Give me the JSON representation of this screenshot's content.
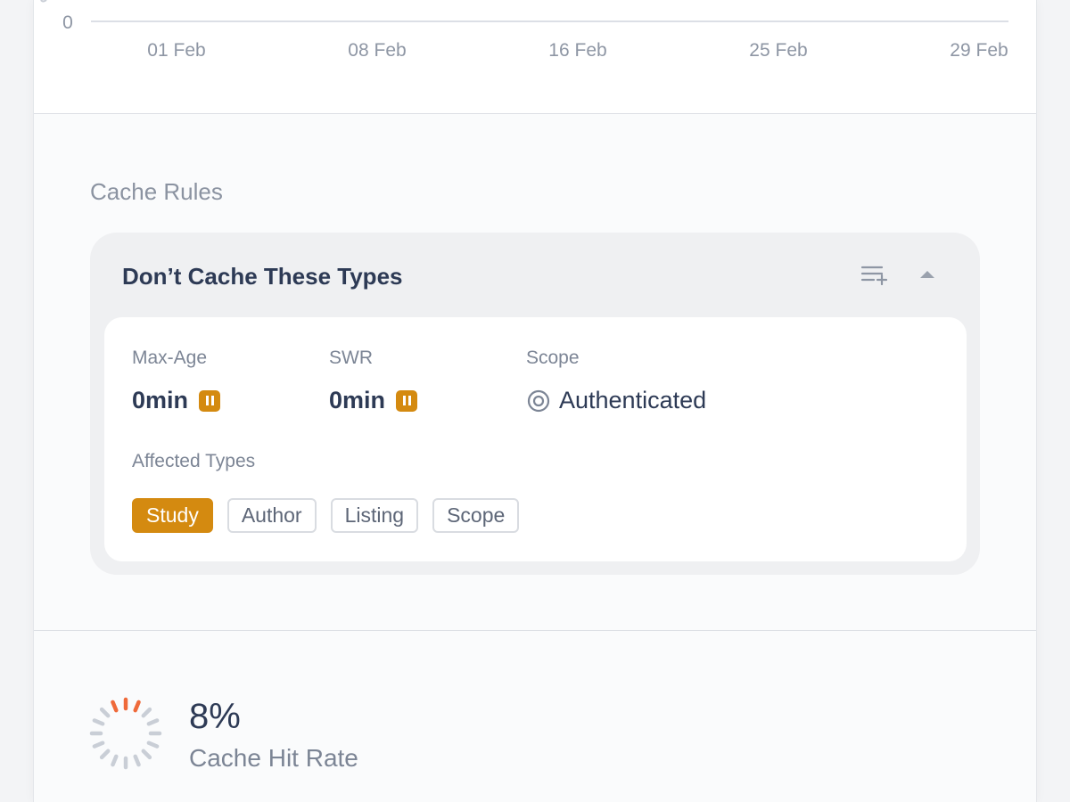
{
  "chart_data": {
    "type": "line",
    "x_ticks": [
      "01 Feb",
      "08 Feb",
      "16 Feb",
      "25 Feb",
      "29 Feb"
    ],
    "y_ticks": [
      "0"
    ],
    "grid": true
  },
  "cache_rules": {
    "section_title": "Cache Rules",
    "rule": {
      "title": "Don’t Cache These Types",
      "add_icon": "list-add-icon",
      "collapse_icon": "caret-up-icon",
      "max_age": {
        "label": "Max-Age",
        "value": "0min",
        "badge_icon": "pause-icon"
      },
      "swr": {
        "label": "SWR",
        "value": "0min",
        "badge_icon": "pause-icon"
      },
      "scope": {
        "label": "Scope",
        "value": "Authenticated",
        "icon": "target-icon"
      },
      "affected_types": {
        "label": "Affected Types",
        "items": [
          {
            "label": "Study",
            "active": true
          },
          {
            "label": "Author",
            "active": false
          },
          {
            "label": "Listing",
            "active": false
          },
          {
            "label": "Scope",
            "active": false
          }
        ]
      }
    }
  },
  "stats": {
    "cache_hit_rate": {
      "value": "8%",
      "label": "Cache Hit Rate",
      "fraction": 0.08
    }
  },
  "colors": {
    "accent": "#d48a10",
    "spinner_active": "#ef6a3a",
    "spinner_inactive": "#c9ced6",
    "text_primary": "#2d3a55",
    "text_muted": "#7c8595"
  }
}
